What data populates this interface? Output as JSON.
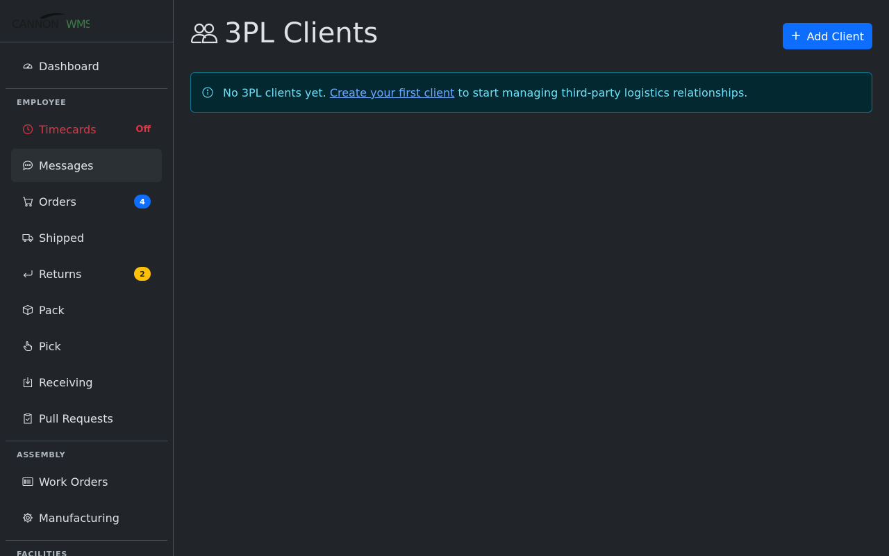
{
  "brand": {
    "logo_word": "CANNON",
    "logo_suffix": "WMS"
  },
  "sidebar": {
    "dashboard": {
      "label": "Dashboard",
      "icon": "speedometer-icon"
    },
    "sections": {
      "employee": "EMPLOYEE",
      "assembly": "ASSEMBLY",
      "facilities": "FACILITIES"
    },
    "timecards": {
      "label": "Timecards",
      "status": "Off",
      "icon": "clock-icon"
    },
    "messages": {
      "label": "Messages",
      "icon": "chat-dots-icon"
    },
    "orders": {
      "label": "Orders",
      "badge": "4",
      "icon": "cart-icon"
    },
    "shipped": {
      "label": "Shipped",
      "icon": "truck-icon"
    },
    "returns": {
      "label": "Returns",
      "badge": "2",
      "icon": "return-arrow-icon"
    },
    "pack": {
      "label": "Pack",
      "icon": "box-icon"
    },
    "pick": {
      "label": "Pick",
      "icon": "hand-pointer-icon"
    },
    "receiving": {
      "label": "Receiving",
      "icon": "box-arrow-in-down-icon"
    },
    "pull_requests": {
      "label": "Pull Requests",
      "icon": "clipboard-check-icon"
    },
    "work_orders": {
      "label": "Work Orders",
      "icon": "card-list-icon"
    },
    "manufacturing": {
      "label": "Manufacturing",
      "icon": "gear-icon"
    }
  },
  "main": {
    "title": "3PL Clients",
    "add_button": "Add Client",
    "alert": {
      "text_before": "No 3PL clients yet.",
      "link": "Create your first client",
      "text_after": "to start managing third-party logistics relationships."
    }
  },
  "colors": {
    "background": "#212529",
    "primary": "#0d6efd",
    "danger": "#dc3545",
    "warning": "#ffc107",
    "info_text": "#6edff6",
    "info_bg": "#032830",
    "logo_accent": "#3a7d44"
  }
}
